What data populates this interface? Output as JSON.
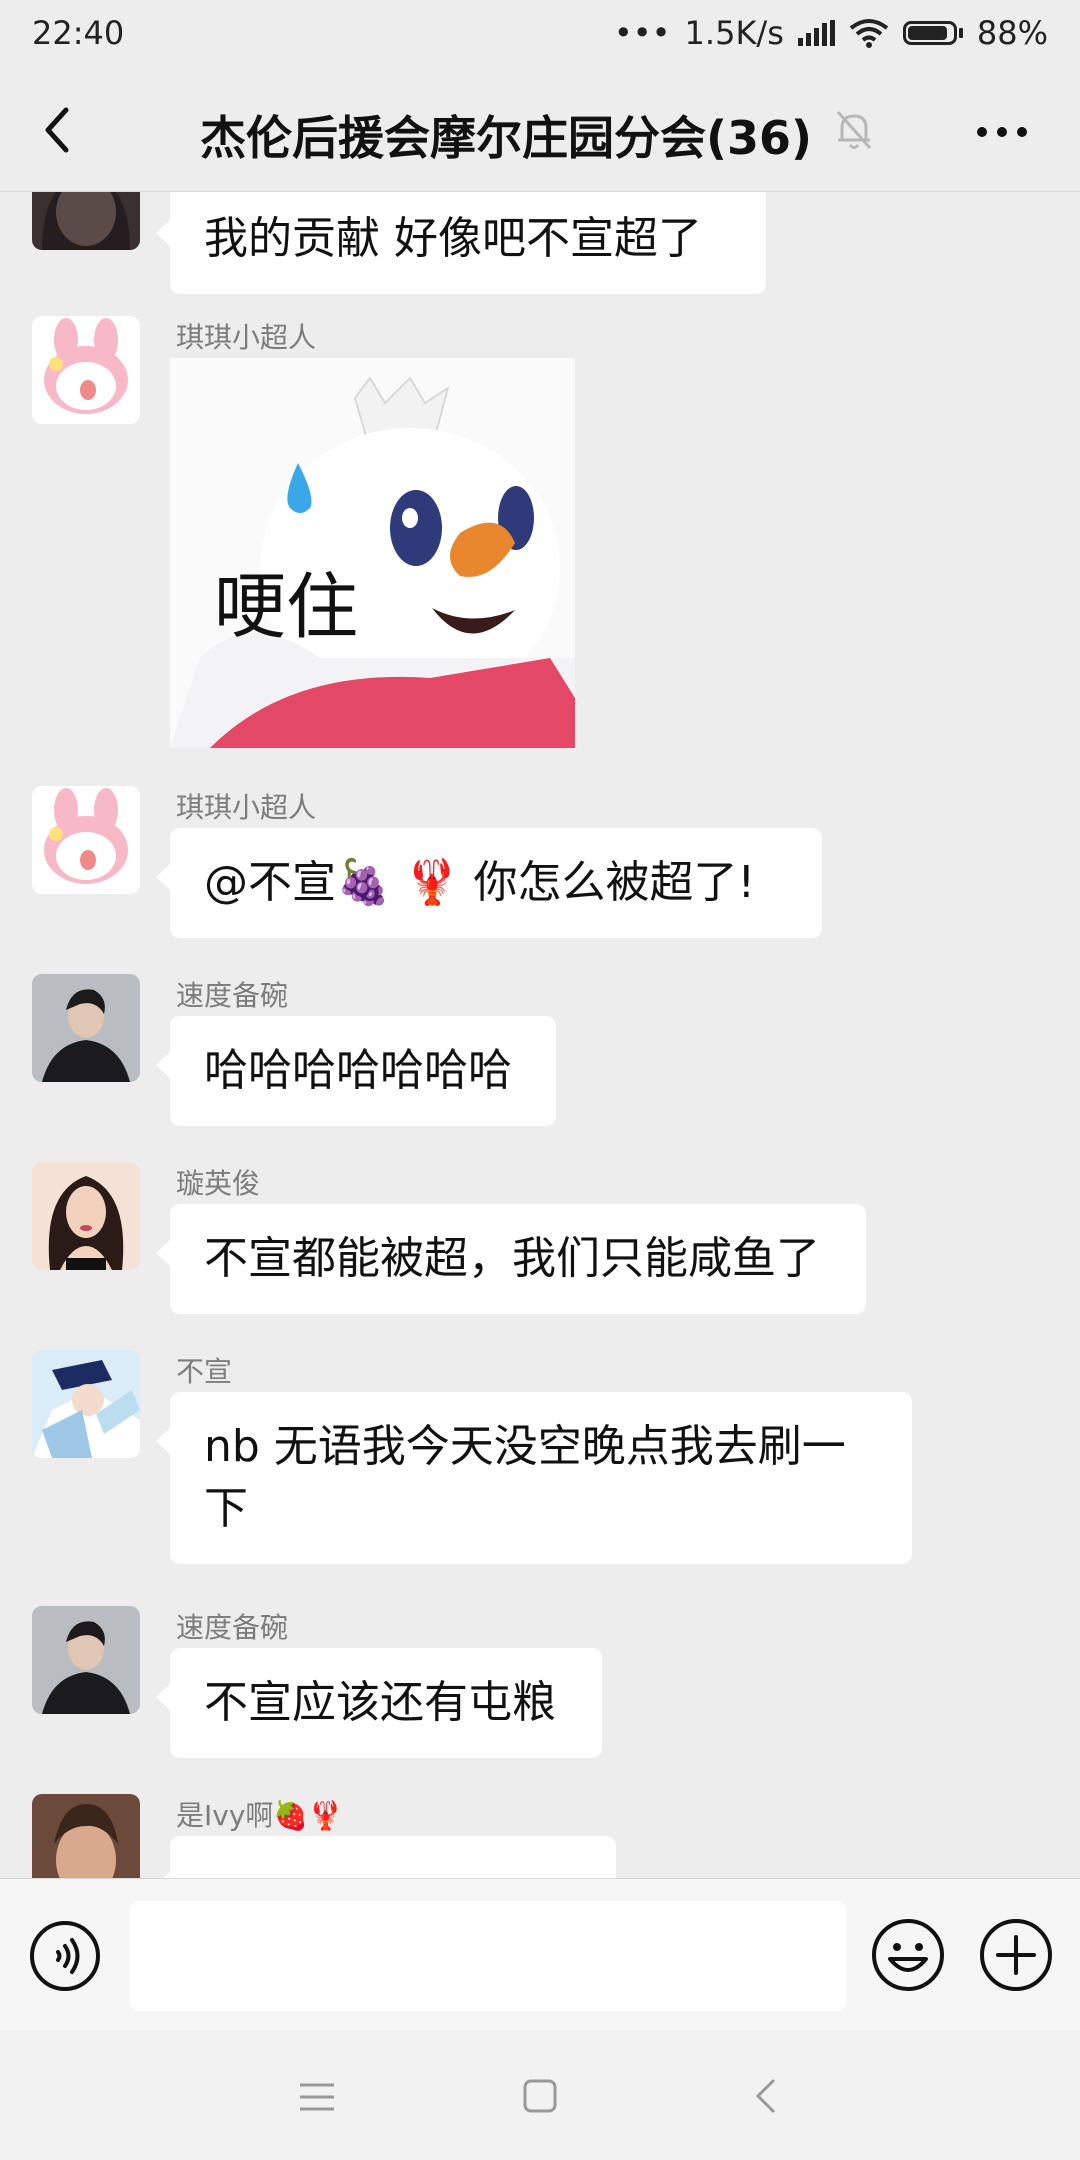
{
  "status_bar": {
    "time": "22:40",
    "network_speed": "1.5K/s",
    "battery_percent": "88%",
    "battery_level": 0.88,
    "icons": [
      "dots-icon",
      "signal-icon",
      "wifi-icon",
      "battery-icon"
    ]
  },
  "header": {
    "title": "杰伦后援会摩尔庄园分会(36)",
    "icons": [
      "back-arrow-icon",
      "mute-bell-icon",
      "more-dots-icon"
    ]
  },
  "messages": [
    {
      "sender": "",
      "type": "text",
      "text": "我的贡献  好像吧不宣超了"
    },
    {
      "sender": "琪琪小超人",
      "type": "sticker",
      "sticker_text": "哽住"
    },
    {
      "sender": "琪琪小超人",
      "type": "text",
      "text": "@不宣🍇 🦞 你怎么被超了!"
    },
    {
      "sender": "速度备碗",
      "type": "text",
      "text": "哈哈哈哈哈哈哈"
    },
    {
      "sender": "璇英俊",
      "type": "text",
      "text": "不宣都能被超，我们只能咸鱼了"
    },
    {
      "sender": "不宣",
      "type": "text",
      "text": "nb 无语我今天没空晚点我去刷一下"
    },
    {
      "sender": "速度备碗",
      "type": "text",
      "text": "不宣应该还有屯粮"
    },
    {
      "sender": "是Ivy啊🍓🦞",
      "type": "text",
      "text": ""
    }
  ],
  "input_bar": {
    "placeholder": "",
    "icons": [
      "voice-icon",
      "emoji-icon",
      "plus-icon"
    ]
  },
  "system_nav": {
    "icons": [
      "menu-icon",
      "home-square-icon",
      "back-chevron-icon"
    ]
  },
  "colors": {
    "background": "#ededed",
    "bubble": "#ffffff",
    "sender_name": "#7d7d7d",
    "text": "#111111"
  }
}
